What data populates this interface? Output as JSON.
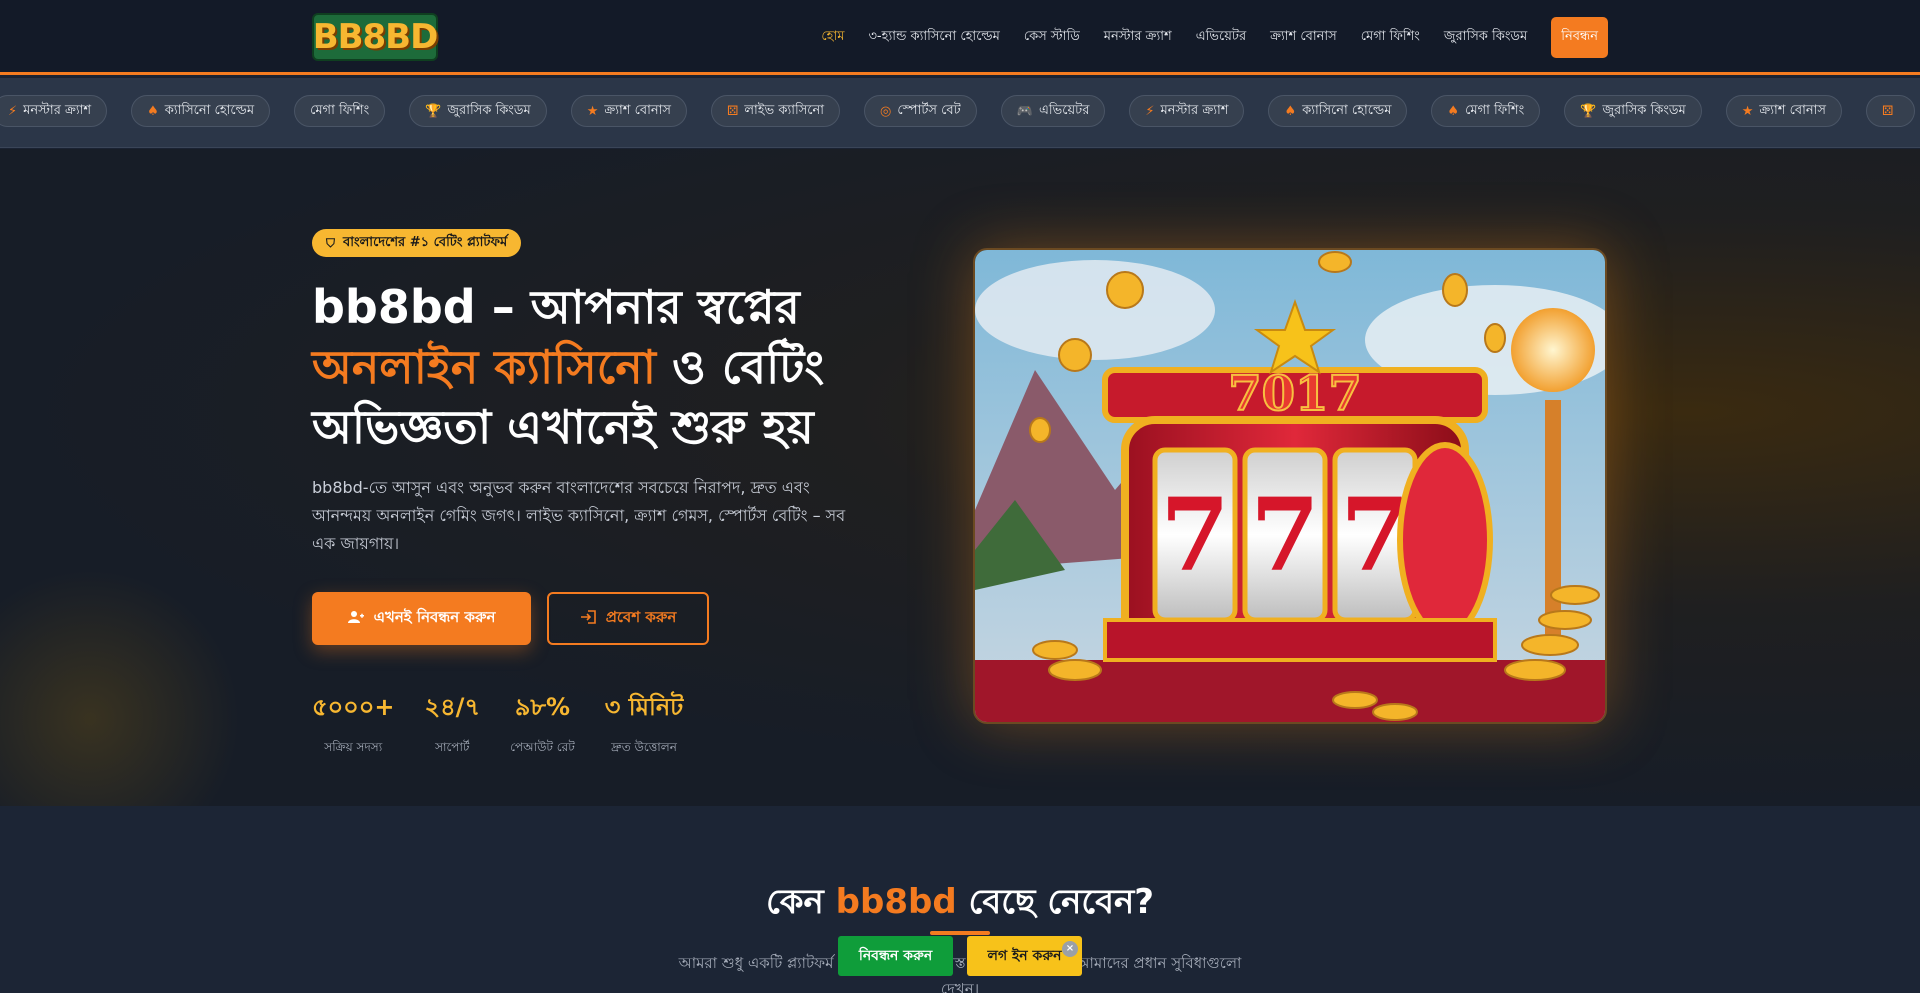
{
  "header": {
    "logo_text": "BB8BD",
    "nav": [
      {
        "label": "হোম",
        "active": true
      },
      {
        "label": "৩-হ্যান্ড ক্যাসিনো হোল্ডেম"
      },
      {
        "label": "কেস স্টাডি"
      },
      {
        "label": "মনস্টার ক্র্যাশ"
      },
      {
        "label": "এভিয়েটর"
      },
      {
        "label": "ক্র্যাশ বোনাস"
      },
      {
        "label": "মেগা ফিশিং"
      },
      {
        "label": "জুরাসিক কিংডম"
      }
    ],
    "register_label": "নিবন্ধন"
  },
  "ticker": [
    {
      "label": "মনস্টার ক্র্যাশ",
      "icon": "bolt-icon"
    },
    {
      "label": "ক্যাসিনো হোল্ডেম",
      "icon": "spade-icon"
    },
    {
      "label": "মেগা ফিশিং",
      "icon": "fish-icon"
    },
    {
      "label": "জুরাসিক কিংডম",
      "icon": "trophy-icon"
    },
    {
      "label": "ক্র্যাশ বোনাস",
      "icon": "star-icon"
    },
    {
      "label": "লাইভ ক্যাসিনো",
      "icon": "dice-icon"
    },
    {
      "label": "স্পোর্টস বেট",
      "icon": "coins-icon"
    },
    {
      "label": "এভিয়েটর",
      "icon": "gamepad-icon"
    },
    {
      "label": "মনস্টার ক্র্যাশ",
      "icon": "bolt-icon"
    },
    {
      "label": "ক্যাসিনো হোল্ডেম",
      "icon": "spade-icon"
    },
    {
      "label": "মেগা ফিশিং",
      "icon": "spade-icon"
    },
    {
      "label": "জুরাসিক কিংডম",
      "icon": "trophy-icon"
    },
    {
      "label": "ক্র্যাশ বোনাস",
      "icon": "star-icon"
    },
    {
      "label": "",
      "icon": "dice-icon"
    }
  ],
  "hero": {
    "badge": "বাংলাদেশের #১ বেটিং প্ল্যাটফর্ম",
    "title_part1": "bb8bd – আপনার স্বপ্নের",
    "title_highlight": "অনলাইন ক্যাসিনো",
    "title_part2": " ও বেটিং অভিজ্ঞতা এখানেই শুরু হয়",
    "description": "bb8bd-তে আসুন এবং অনুভব করুন বাংলাদেশের সবচেয়ে নিরাপদ, দ্রুত এবং আনন্দময় অনলাইন গেমিং জগৎ। লাইভ ক্যাসিনো, ক্র্যাশ গেমস, স্পোর্টস বেটিং – সব এক জায়গায়।",
    "primary_button": "এখনই নিবন্ধন করুন",
    "secondary_button": "প্রবেশ করুন",
    "stats": [
      {
        "value": "৫০০০+",
        "label": "সক্রিয় সদস্য"
      },
      {
        "value": "২৪/৭",
        "label": "সাপোর্ট"
      },
      {
        "value": "৯৮%",
        "label": "পেআউট রেট"
      },
      {
        "value": "৩ মিনিট",
        "label": "দ্রুত উত্তোলন"
      }
    ],
    "image_reel_text": "7017"
  },
  "why": {
    "title_part1": "কেন ",
    "title_highlight": "bb8bd",
    "title_part2": " বেছে নেবেন?",
    "description": "আমরা শুধু একটি প্ল্যাটফর্ম নই — আপনার বিশ্বস্ত গেমিং সঙ্গী। নিচে আমাদের প্রধান সুবিধাগুলো দেখুন।"
  },
  "floating": {
    "register": "নিবন্ধন করুন",
    "login": "লগ ইন করুন",
    "close": "×"
  },
  "colors": {
    "accent": "#f47b20",
    "gold": "#f7b731",
    "green": "#0f9d3a",
    "background": "#1a2232"
  }
}
